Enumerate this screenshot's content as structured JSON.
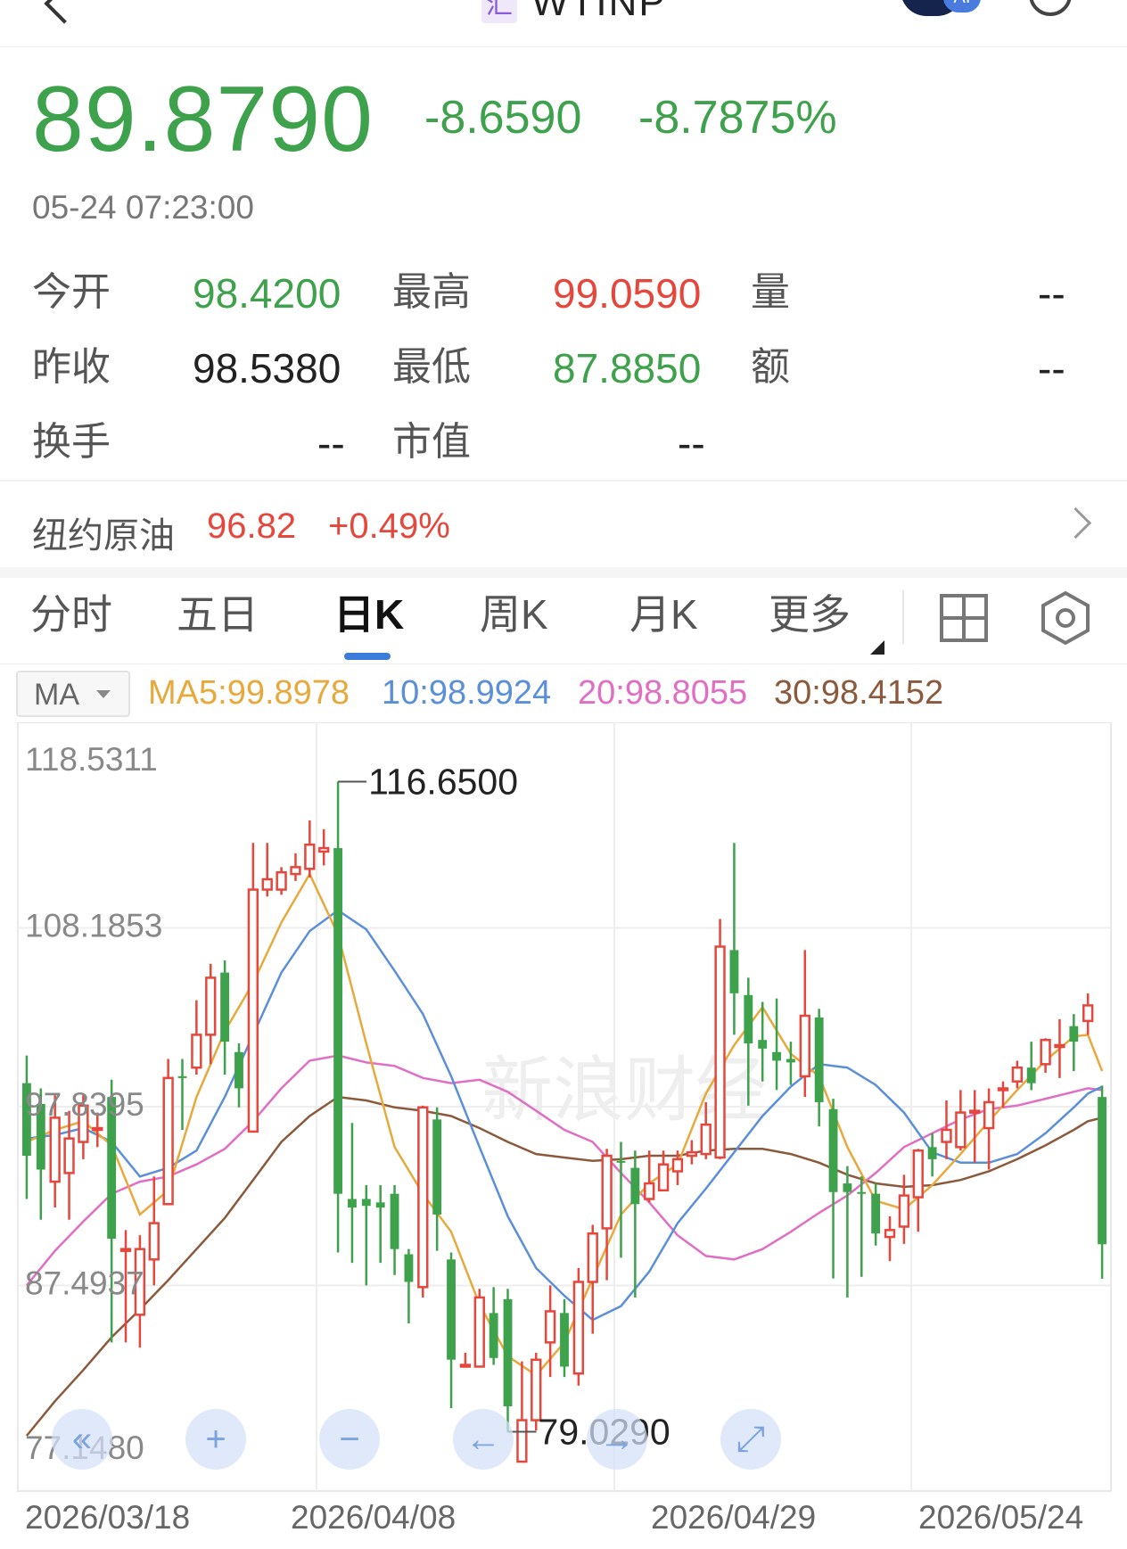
{
  "header": {
    "title": "WTINP",
    "badge_char": "汇",
    "ai_label": "AI"
  },
  "quote": {
    "price": "89.8790",
    "change": "-8.6590",
    "change_pct": "-8.7875%",
    "time": "05-24 07:23:00",
    "open_label": "今开",
    "open": "98.4200",
    "high_label": "最高",
    "high": "99.0590",
    "volume_label": "量",
    "volume": "--",
    "prev_close_label": "昨收",
    "prev_close": "98.5380",
    "low_label": "最低",
    "low": "87.8850",
    "amount_label": "额",
    "amount": "--",
    "turnover_label": "换手",
    "turnover": "--",
    "mktcap_label": "市值",
    "mktcap": "--"
  },
  "related": {
    "name": "纽约原油",
    "price": "96.82",
    "change_pct": "+0.49%"
  },
  "tabs": [
    {
      "label": "分时",
      "active": false
    },
    {
      "label": "五日",
      "active": false
    },
    {
      "label": "日K",
      "active": true
    },
    {
      "label": "周K",
      "active": false
    },
    {
      "label": "月K",
      "active": false
    },
    {
      "label": "更多",
      "active": false
    }
  ],
  "ma_bar": {
    "select_label": "MA",
    "ma5": "MA5:99.8978",
    "ma10": "10:98.9924",
    "ma20": "20:98.8055",
    "ma30": "30:98.4152"
  },
  "colors": {
    "up": "#e5473c",
    "down": "#3ea14b",
    "ma5": "#e8a93c",
    "ma10": "#5b8fd9",
    "ma20": "#e06fc3",
    "ma30": "#8b5a3c",
    "accent": "#3a7bdc"
  },
  "icons": {
    "grid": "grid-icon",
    "settings": "hexagon-settings-icon",
    "chevron": "chevron-right-icon"
  },
  "watermark": "新浪财经",
  "chart_data": {
    "type": "candlestick",
    "y_axis_labels": [
      "118.5311",
      "108.1853",
      "97.8395",
      "87.4937",
      "77.1480"
    ],
    "ylim": [
      77.148,
      118.5311
    ],
    "x_axis_labels": [
      "2026/03/18",
      "2026/04/08",
      "2026/04/29",
      "2026/05/24"
    ],
    "max_label": "116.6500",
    "min_label": "79.0290",
    "grid": true,
    "candles": [
      [
        99.2,
        95.0,
        100.8,
        92.5
      ],
      [
        98.0,
        94.2,
        98.9,
        91.3
      ],
      [
        93.5,
        97.2,
        98.5,
        92.0
      ],
      [
        94.0,
        96.0,
        97.6,
        91.3
      ],
      [
        95.8,
        97.9,
        98.5,
        94.8
      ],
      [
        96.5,
        96.6,
        97.5,
        95.5
      ],
      [
        98.4,
        90.2,
        99.4,
        84.2
      ],
      [
        89.5,
        89.6,
        90.7,
        84.2
      ],
      [
        85.8,
        89.6,
        90.4,
        83.9
      ],
      [
        89.0,
        91.1,
        93.8,
        87.5
      ],
      [
        92.2,
        99.5,
        100.6,
        92.2
      ],
      [
        99.6,
        99.5,
        100.6,
        96.5
      ],
      [
        100.1,
        102.0,
        104.0,
        99.7
      ],
      [
        102.0,
        105.3,
        106.1,
        100.3
      ],
      [
        105.6,
        101.6,
        106.3,
        99.7
      ],
      [
        101.0,
        98.9,
        101.5,
        97.8
      ],
      [
        96.4,
        110.4,
        113.1,
        96.4
      ],
      [
        110.4,
        111.0,
        113.1,
        110.0
      ],
      [
        110.4,
        111.4,
        111.7,
        110.1
      ],
      [
        111.3,
        111.7,
        112.5,
        110.9
      ],
      [
        111.6,
        113.0,
        114.4,
        111.1
      ],
      [
        112.6,
        112.8,
        113.9,
        111.8
      ],
      [
        112.8,
        92.8,
        116.65,
        89.4
      ],
      [
        92.5,
        92.0,
        96.9,
        88.8
      ],
      [
        92.5,
        92.1,
        93.3,
        87.5
      ],
      [
        92.3,
        92.0,
        93.3,
        88.8
      ],
      [
        92.8,
        89.6,
        93.3,
        88.1
      ],
      [
        89.3,
        87.7,
        89.6,
        85.3
      ],
      [
        87.4,
        97.8,
        97.9,
        86.8
      ],
      [
        97.1,
        91.6,
        97.8,
        89.5
      ],
      [
        89.0,
        83.2,
        89.4,
        80.4
      ],
      [
        82.9,
        82.9,
        83.6,
        82.8
      ],
      [
        82.8,
        86.8,
        87.3,
        82.8
      ],
      [
        85.9,
        83.3,
        87.4,
        82.9
      ],
      [
        86.7,
        80.5,
        87.3,
        79.029
      ],
      [
        77.3,
        79.7,
        83.1,
        79.2
      ],
      [
        79.7,
        83.2,
        83.6,
        79.1
      ],
      [
        84.2,
        86.0,
        87.5,
        82.2
      ],
      [
        85.9,
        82.8,
        86.7,
        82.2
      ],
      [
        82.4,
        87.7,
        88.5,
        81.7
      ],
      [
        87.7,
        90.5,
        91.0,
        84.7
      ],
      [
        90.8,
        95.0,
        95.4,
        87.8
      ],
      [
        94.7,
        94.6,
        95.8,
        89.1
      ],
      [
        94.3,
        92.2,
        95.3,
        86.8
      ],
      [
        92.5,
        93.4,
        95.3,
        92.3
      ],
      [
        93.0,
        94.5,
        95.3,
        93.1
      ],
      [
        94.1,
        94.8,
        95.3,
        93.3
      ],
      [
        95.0,
        95.2,
        95.9,
        94.5
      ],
      [
        95.1,
        96.8,
        98.1,
        94.8
      ],
      [
        94.9,
        107.1,
        108.7,
        94.8
      ],
      [
        106.9,
        104.4,
        113.1,
        102.0
      ],
      [
        104.3,
        101.5,
        105.3,
        97.9
      ],
      [
        101.7,
        101.2,
        103.9,
        99.3
      ],
      [
        101.0,
        100.5,
        104.1,
        98.8
      ],
      [
        100.6,
        100.4,
        101.6,
        99.1
      ],
      [
        99.6,
        103.1,
        106.9,
        98.4
      ],
      [
        103.0,
        98.1,
        103.5,
        96.7
      ],
      [
        97.7,
        92.9,
        98.3,
        87.9
      ],
      [
        93.4,
        92.9,
        94.4,
        86.8
      ],
      [
        92.9,
        92.8,
        93.8,
        88.0
      ],
      [
        92.8,
        90.5,
        93.4,
        89.8
      ],
      [
        90.3,
        90.7,
        91.5,
        88.9
      ],
      [
        90.9,
        92.7,
        93.9,
        89.9
      ],
      [
        92.6,
        95.3,
        95.4,
        90.6
      ],
      [
        95.5,
        94.8,
        96.3,
        93.8
      ],
      [
        95.8,
        96.5,
        98.2,
        94.8
      ],
      [
        95.5,
        97.5,
        98.8,
        95.3
      ],
      [
        97.6,
        97.6,
        98.8,
        94.6
      ],
      [
        96.6,
        98.1,
        98.9,
        94.2
      ],
      [
        98.8,
        98.9,
        99.3,
        97.8
      ],
      [
        99.3,
        100.1,
        100.5,
        98.9
      ],
      [
        100.1,
        99.2,
        101.6,
        98.8
      ],
      [
        100.3,
        101.7,
        101.8,
        99.8
      ],
      [
        101.3,
        101.4,
        102.9,
        99.5
      ],
      [
        102.5,
        101.6,
        103.2,
        99.9
      ],
      [
        102.8,
        103.7,
        104.4,
        102.0
      ],
      [
        98.4,
        89.879,
        99.059,
        87.885
      ]
    ],
    "ma5": [
      [
        0,
        95.8
      ],
      [
        2,
        96.5
      ],
      [
        4,
        97.0
      ],
      [
        6,
        95.6
      ],
      [
        8,
        91.6
      ],
      [
        10,
        93.0
      ],
      [
        12,
        98.4
      ],
      [
        14,
        102.2
      ],
      [
        16,
        105.0
      ],
      [
        18,
        108.5
      ],
      [
        20,
        111.3
      ],
      [
        22,
        107.8
      ],
      [
        24,
        101.5
      ],
      [
        26,
        95.5
      ],
      [
        28,
        92.8
      ],
      [
        30,
        90.6
      ],
      [
        32,
        86.4
      ],
      [
        34,
        83.4
      ],
      [
        36,
        82.3
      ],
      [
        38,
        84.2
      ],
      [
        40,
        87.9
      ],
      [
        42,
        91.6
      ],
      [
        44,
        93.4
      ],
      [
        46,
        94.5
      ],
      [
        48,
        98.6
      ],
      [
        50,
        101.4
      ],
      [
        52,
        103.6
      ],
      [
        54,
        100.9
      ],
      [
        56,
        99.6
      ],
      [
        58,
        95.5
      ],
      [
        60,
        92.4
      ],
      [
        62,
        91.9
      ],
      [
        64,
        93.3
      ],
      [
        66,
        95.1
      ],
      [
        68,
        97.0
      ],
      [
        70,
        98.8
      ],
      [
        72,
        100.5
      ],
      [
        74,
        101.9
      ],
      [
        75,
        102.0
      ],
      [
        76,
        99.9
      ]
    ],
    "ma10": [
      [
        0,
        96.0
      ],
      [
        2,
        96.2
      ],
      [
        4,
        96.6
      ],
      [
        6,
        95.8
      ],
      [
        8,
        93.8
      ],
      [
        10,
        94.3
      ],
      [
        12,
        95.3
      ],
      [
        14,
        98.4
      ],
      [
        16,
        102.0
      ],
      [
        18,
        105.6
      ],
      [
        20,
        108.0
      ],
      [
        22,
        109.2
      ],
      [
        24,
        108.1
      ],
      [
        26,
        105.7
      ],
      [
        28,
        103.2
      ],
      [
        30,
        99.6
      ],
      [
        32,
        95.5
      ],
      [
        34,
        91.5
      ],
      [
        36,
        88.5
      ],
      [
        38,
        86.9
      ],
      [
        40,
        85.5
      ],
      [
        42,
        86.3
      ],
      [
        44,
        88.3
      ],
      [
        46,
        91.1
      ],
      [
        48,
        93.1
      ],
      [
        50,
        95.2
      ],
      [
        52,
        97.3
      ],
      [
        54,
        99.0
      ],
      [
        56,
        100.3
      ],
      [
        58,
        100.1
      ],
      [
        60,
        99.1
      ],
      [
        62,
        97.5
      ],
      [
        64,
        95.2
      ],
      [
        66,
        94.6
      ],
      [
        68,
        94.6
      ],
      [
        70,
        95.1
      ],
      [
        72,
        96.3
      ],
      [
        74,
        97.8
      ],
      [
        75,
        98.6
      ],
      [
        76,
        99.0
      ]
    ],
    "ma20": [
      [
        0,
        87.5
      ],
      [
        2,
        89.5
      ],
      [
        4,
        91.2
      ],
      [
        6,
        92.8
      ],
      [
        8,
        93.5
      ],
      [
        10,
        93.8
      ],
      [
        12,
        94.5
      ],
      [
        14,
        95.4
      ],
      [
        16,
        97.0
      ],
      [
        18,
        98.9
      ],
      [
        20,
        100.5
      ],
      [
        22,
        100.8
      ],
      [
        24,
        100.4
      ],
      [
        26,
        100.2
      ],
      [
        28,
        99.5
      ],
      [
        30,
        99.2
      ],
      [
        32,
        99.4
      ],
      [
        34,
        98.7
      ],
      [
        36,
        97.6
      ],
      [
        38,
        96.5
      ],
      [
        40,
        95.8
      ],
      [
        42,
        94.0
      ],
      [
        44,
        92.3
      ],
      [
        46,
        90.4
      ],
      [
        48,
        89.2
      ],
      [
        50,
        89.0
      ],
      [
        52,
        89.6
      ],
      [
        54,
        90.6
      ],
      [
        56,
        91.7
      ],
      [
        58,
        92.7
      ],
      [
        60,
        94.0
      ],
      [
        62,
        95.5
      ],
      [
        64,
        96.3
      ],
      [
        66,
        97.1
      ],
      [
        68,
        97.7
      ],
      [
        70,
        97.9
      ],
      [
        72,
        98.3
      ],
      [
        74,
        98.7
      ],
      [
        75,
        98.9
      ],
      [
        76,
        98.8
      ]
    ],
    "ma30": [
      [
        0,
        78.8
      ],
      [
        2,
        80.8
      ],
      [
        4,
        82.6
      ],
      [
        6,
        84.5
      ],
      [
        8,
        86.1
      ],
      [
        10,
        87.8
      ],
      [
        12,
        89.6
      ],
      [
        14,
        91.4
      ],
      [
        16,
        93.6
      ],
      [
        18,
        95.8
      ],
      [
        20,
        97.3
      ],
      [
        22,
        98.4
      ],
      [
        24,
        98.2
      ],
      [
        26,
        97.8
      ],
      [
        28,
        97.6
      ],
      [
        30,
        97.3
      ],
      [
        32,
        96.6
      ],
      [
        34,
        95.8
      ],
      [
        36,
        95.1
      ],
      [
        38,
        94.9
      ],
      [
        40,
        94.7
      ],
      [
        42,
        94.8
      ],
      [
        44,
        95.0
      ],
      [
        46,
        95.0
      ],
      [
        48,
        95.3
      ],
      [
        50,
        95.4
      ],
      [
        52,
        95.4
      ],
      [
        54,
        95.1
      ],
      [
        56,
        94.6
      ],
      [
        58,
        93.9
      ],
      [
        60,
        93.4
      ],
      [
        62,
        93.2
      ],
      [
        64,
        93.3
      ],
      [
        66,
        93.6
      ],
      [
        68,
        94.1
      ],
      [
        70,
        94.8
      ],
      [
        72,
        95.6
      ],
      [
        74,
        96.5
      ],
      [
        75,
        97.0
      ],
      [
        76,
        97.2
      ]
    ]
  }
}
